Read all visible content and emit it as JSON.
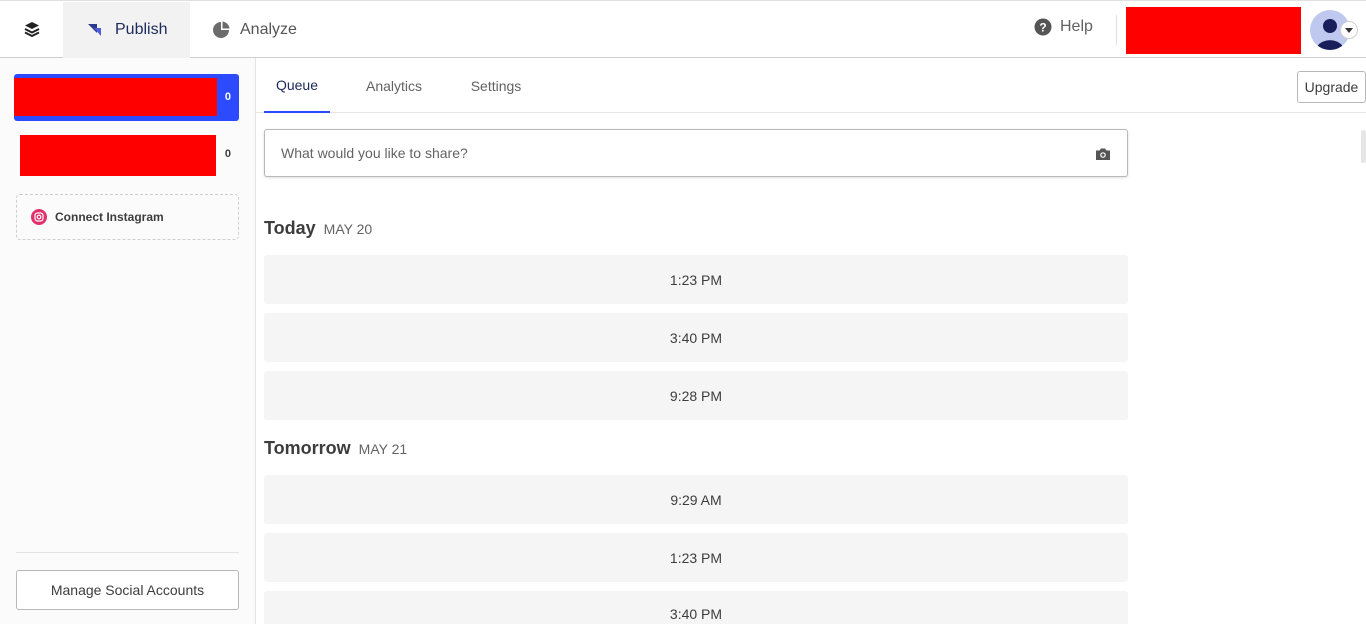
{
  "topbar": {
    "publish_label": "Publish",
    "analyze_label": "Analyze",
    "help_label": "Help"
  },
  "sidebar": {
    "accounts": [
      {
        "count": "0",
        "selected": true
      },
      {
        "count": "0",
        "selected": false
      }
    ],
    "connect_instagram_label": "Connect Instagram",
    "manage_button_label": "Manage Social Accounts"
  },
  "tabs": [
    {
      "label": "Queue",
      "active": true
    },
    {
      "label": "Analytics",
      "active": false
    },
    {
      "label": "Settings",
      "active": false
    }
  ],
  "upgrade_label": "Upgrade",
  "composer": {
    "placeholder": "What would you like to share?"
  },
  "queue": {
    "days": [
      {
        "name": "Today",
        "date": "MAY 20",
        "slots": [
          "1:23 PM",
          "3:40 PM",
          "9:28 PM"
        ]
      },
      {
        "name": "Tomorrow",
        "date": "MAY 21",
        "slots": [
          "9:29 AM",
          "1:23 PM",
          "3:40 PM"
        ]
      }
    ]
  },
  "colors": {
    "accent": "#2c4bff",
    "redaction": "#ff0000",
    "instagram": "#e1306c"
  }
}
